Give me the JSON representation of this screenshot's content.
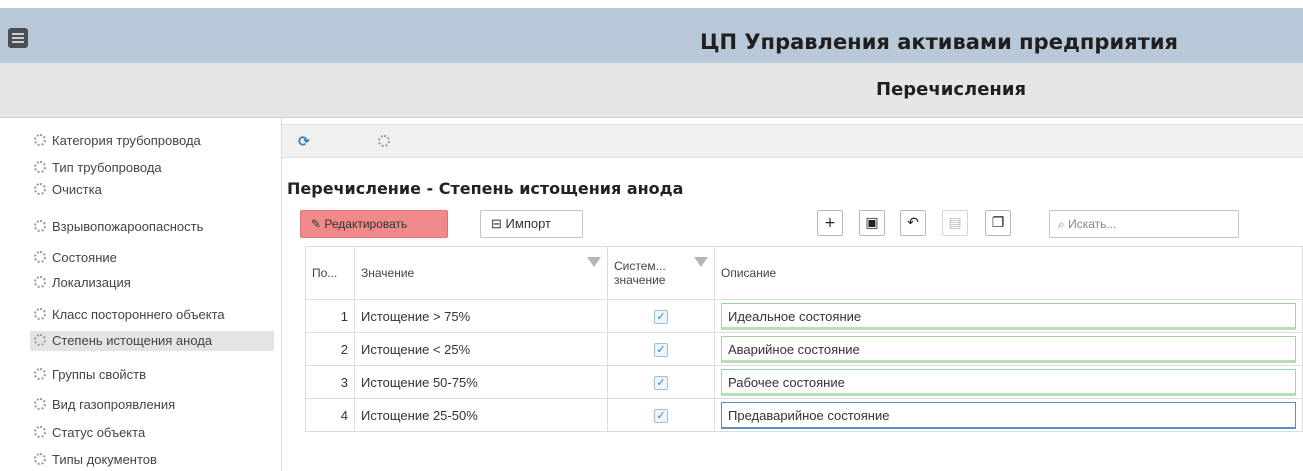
{
  "header": {
    "app_title": "ЦП Управления активами предприятия"
  },
  "subheader": {
    "page_title": "Перечисления"
  },
  "sidebar": {
    "items": [
      {
        "label": "Категория трубопровода"
      },
      {
        "label": "Тип трубопровода"
      },
      {
        "label": "Очистка"
      },
      {
        "label": "Взрывопожароопасность"
      },
      {
        "label": "Состояние"
      },
      {
        "label": "Локализация"
      },
      {
        "label": "Класс постороннего объекта"
      },
      {
        "label": "Степень истощения анода",
        "active": true
      },
      {
        "label": "Группы свойств"
      },
      {
        "label": "Вид газопроявления"
      },
      {
        "label": "Статус объекта"
      },
      {
        "label": "Типы документов"
      }
    ]
  },
  "section": {
    "title": "Перечисление - Степень истощения анода"
  },
  "actions": {
    "edit_label": "Редактировать",
    "import_label": "Импорт",
    "search_placeholder": "Искать..."
  },
  "table": {
    "headers": {
      "pos": "По...",
      "value": "Значение",
      "system_line1": "Систем...",
      "system_line2": "значение",
      "description": "Описание"
    },
    "rows": [
      {
        "pos": "1",
        "value": "Истощение > 75%",
        "system": true,
        "description": "Идеальное состояние"
      },
      {
        "pos": "2",
        "value": "Истощение < 25%",
        "system": true,
        "description": "Аварийное состояние"
      },
      {
        "pos": "3",
        "value": "Истощение 50-75%",
        "system": true,
        "description": "Рабочее состояние"
      },
      {
        "pos": "4",
        "value": "Истощение 25-50%",
        "system": true,
        "description": "Предаварийное состояние"
      }
    ]
  },
  "colors": {
    "header_bg": "#b9c8d9",
    "edit_button": "#f08a8a",
    "valid_border": "#9ed29e",
    "focus_border": "#5a8fc2"
  }
}
